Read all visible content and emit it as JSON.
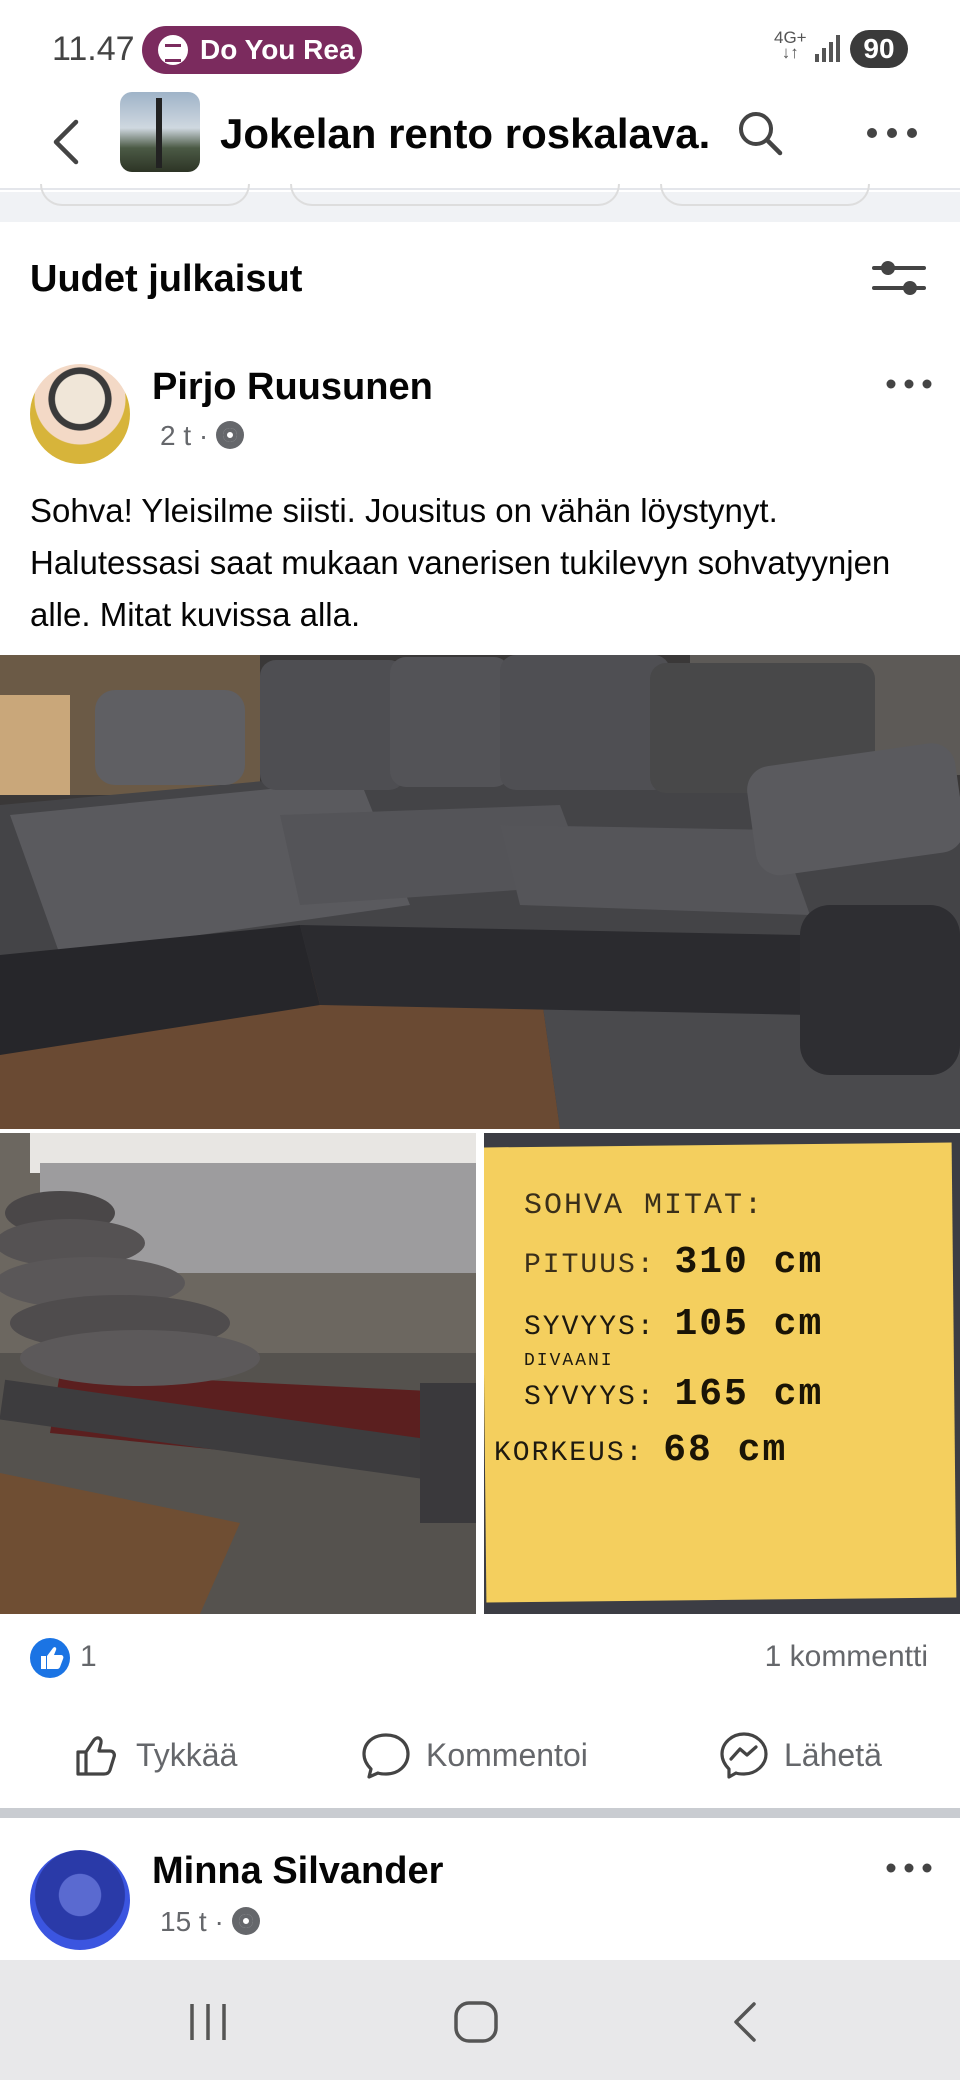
{
  "status": {
    "time": "11.47",
    "media_text": "Do You Rea",
    "network": "4G+",
    "battery": "90"
  },
  "header": {
    "group_name": "Jokelan rento roskalava.",
    "icons": [
      "back-icon",
      "search-icon",
      "more-icon"
    ]
  },
  "feed": {
    "section_title": "Uudet julkaisut"
  },
  "post": {
    "author": "Pirjo Ruusunen",
    "time": "2 t ·",
    "text": "Sohva! Yleisilme siisti. Jousitus on vähän löystynyt. Halutessasi saat mukaan vanerisen tukilevyn sohvatyynjen alle. Mitat kuvissa alla.",
    "note": {
      "title": "SOHVA MITAT:",
      "rows": [
        {
          "label": "PITUUS:",
          "value": "310 cm"
        },
        {
          "label": "SYVYYS:",
          "value": "105 cm"
        },
        {
          "label": "DIVAANI",
          "value": ""
        },
        {
          "label": "SYVYYS:",
          "value": "165 cm"
        },
        {
          "label": "KORKEUS:",
          "value": "68 cm"
        }
      ]
    },
    "like_count": "1",
    "comment_count": "1 kommentti",
    "actions": {
      "like": "Tykkää",
      "comment": "Kommentoi",
      "send": "Lähetä"
    }
  },
  "next_post": {
    "author": "Minna Silvander",
    "time": "15 t ·"
  },
  "colors": {
    "spotify_chip": "#7b2b5e",
    "like_blue": "#1b74e4",
    "note_yellow": "#f4cf5e"
  }
}
